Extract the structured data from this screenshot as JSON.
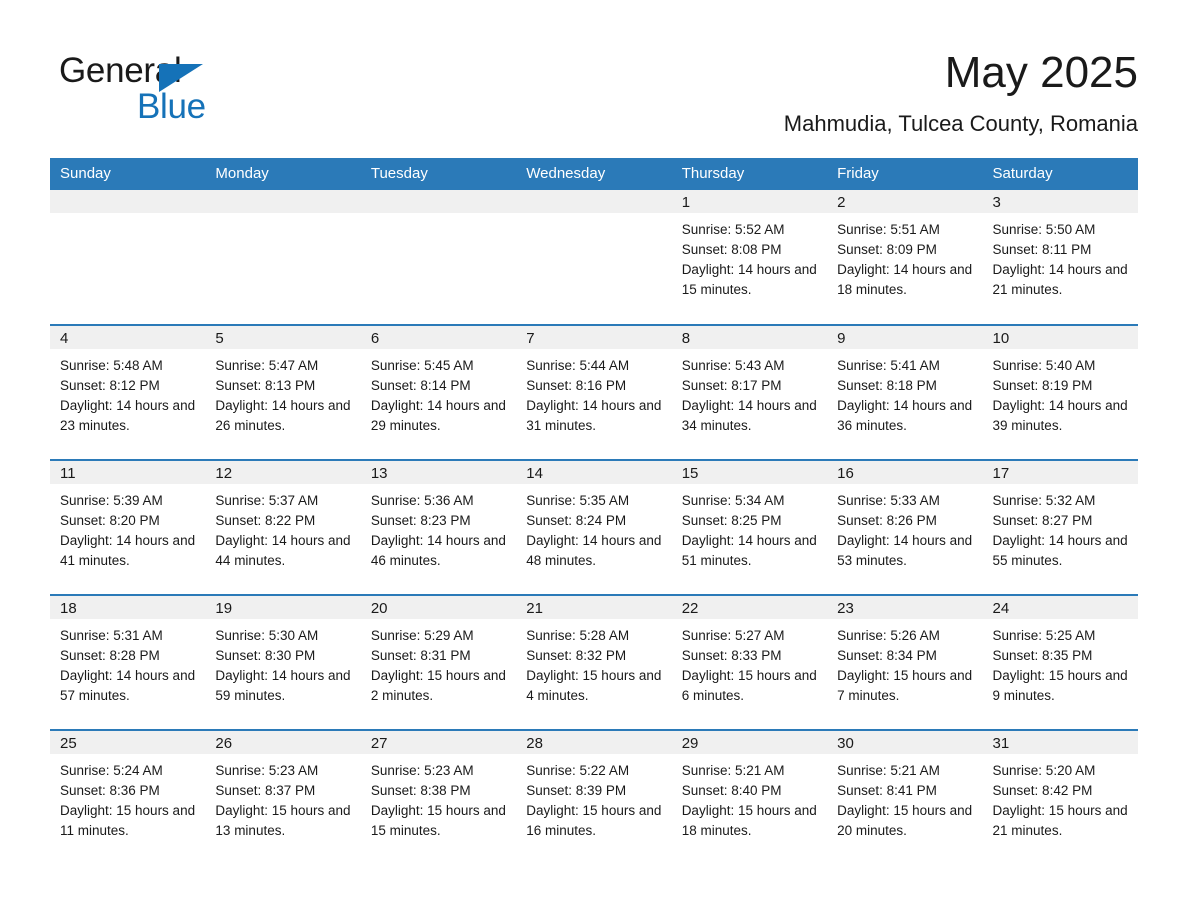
{
  "logo": {
    "word_one": "General",
    "word_two": "Blue",
    "triangle_icon": "triangle-icon",
    "brand_color": "#1572b8"
  },
  "header": {
    "month_title": "May 2025",
    "location": "Mahmudia, Tulcea County, Romania"
  },
  "theme": {
    "header_blue": "#2b7ab8",
    "daynum_band": "#f0f0f0",
    "text": "#1a1a1a"
  },
  "weekday_headers": [
    "Sunday",
    "Monday",
    "Tuesday",
    "Wednesday",
    "Thursday",
    "Friday",
    "Saturday"
  ],
  "labels": {
    "sunrise_prefix": "Sunrise:",
    "sunset_prefix": "Sunset:",
    "daylight_prefix": "Daylight:"
  },
  "weeks": [
    [
      {
        "day": "",
        "sunrise": "",
        "sunset": "",
        "daylight": ""
      },
      {
        "day": "",
        "sunrise": "",
        "sunset": "",
        "daylight": ""
      },
      {
        "day": "",
        "sunrise": "",
        "sunset": "",
        "daylight": ""
      },
      {
        "day": "",
        "sunrise": "",
        "sunset": "",
        "daylight": ""
      },
      {
        "day": "1",
        "sunrise": "Sunrise: 5:52 AM",
        "sunset": "Sunset: 8:08 PM",
        "daylight": "Daylight: 14 hours and 15 minutes."
      },
      {
        "day": "2",
        "sunrise": "Sunrise: 5:51 AM",
        "sunset": "Sunset: 8:09 PM",
        "daylight": "Daylight: 14 hours and 18 minutes."
      },
      {
        "day": "3",
        "sunrise": "Sunrise: 5:50 AM",
        "sunset": "Sunset: 8:11 PM",
        "daylight": "Daylight: 14 hours and 21 minutes."
      }
    ],
    [
      {
        "day": "4",
        "sunrise": "Sunrise: 5:48 AM",
        "sunset": "Sunset: 8:12 PM",
        "daylight": "Daylight: 14 hours and 23 minutes."
      },
      {
        "day": "5",
        "sunrise": "Sunrise: 5:47 AM",
        "sunset": "Sunset: 8:13 PM",
        "daylight": "Daylight: 14 hours and 26 minutes."
      },
      {
        "day": "6",
        "sunrise": "Sunrise: 5:45 AM",
        "sunset": "Sunset: 8:14 PM",
        "daylight": "Daylight: 14 hours and 29 minutes."
      },
      {
        "day": "7",
        "sunrise": "Sunrise: 5:44 AM",
        "sunset": "Sunset: 8:16 PM",
        "daylight": "Daylight: 14 hours and 31 minutes."
      },
      {
        "day": "8",
        "sunrise": "Sunrise: 5:43 AM",
        "sunset": "Sunset: 8:17 PM",
        "daylight": "Daylight: 14 hours and 34 minutes."
      },
      {
        "day": "9",
        "sunrise": "Sunrise: 5:41 AM",
        "sunset": "Sunset: 8:18 PM",
        "daylight": "Daylight: 14 hours and 36 minutes."
      },
      {
        "day": "10",
        "sunrise": "Sunrise: 5:40 AM",
        "sunset": "Sunset: 8:19 PM",
        "daylight": "Daylight: 14 hours and 39 minutes."
      }
    ],
    [
      {
        "day": "11",
        "sunrise": "Sunrise: 5:39 AM",
        "sunset": "Sunset: 8:20 PM",
        "daylight": "Daylight: 14 hours and 41 minutes."
      },
      {
        "day": "12",
        "sunrise": "Sunrise: 5:37 AM",
        "sunset": "Sunset: 8:22 PM",
        "daylight": "Daylight: 14 hours and 44 minutes."
      },
      {
        "day": "13",
        "sunrise": "Sunrise: 5:36 AM",
        "sunset": "Sunset: 8:23 PM",
        "daylight": "Daylight: 14 hours and 46 minutes."
      },
      {
        "day": "14",
        "sunrise": "Sunrise: 5:35 AM",
        "sunset": "Sunset: 8:24 PM",
        "daylight": "Daylight: 14 hours and 48 minutes."
      },
      {
        "day": "15",
        "sunrise": "Sunrise: 5:34 AM",
        "sunset": "Sunset: 8:25 PM",
        "daylight": "Daylight: 14 hours and 51 minutes."
      },
      {
        "day": "16",
        "sunrise": "Sunrise: 5:33 AM",
        "sunset": "Sunset: 8:26 PM",
        "daylight": "Daylight: 14 hours and 53 minutes."
      },
      {
        "day": "17",
        "sunrise": "Sunrise: 5:32 AM",
        "sunset": "Sunset: 8:27 PM",
        "daylight": "Daylight: 14 hours and 55 minutes."
      }
    ],
    [
      {
        "day": "18",
        "sunrise": "Sunrise: 5:31 AM",
        "sunset": "Sunset: 8:28 PM",
        "daylight": "Daylight: 14 hours and 57 minutes."
      },
      {
        "day": "19",
        "sunrise": "Sunrise: 5:30 AM",
        "sunset": "Sunset: 8:30 PM",
        "daylight": "Daylight: 14 hours and 59 minutes."
      },
      {
        "day": "20",
        "sunrise": "Sunrise: 5:29 AM",
        "sunset": "Sunset: 8:31 PM",
        "daylight": "Daylight: 15 hours and 2 minutes."
      },
      {
        "day": "21",
        "sunrise": "Sunrise: 5:28 AM",
        "sunset": "Sunset: 8:32 PM",
        "daylight": "Daylight: 15 hours and 4 minutes."
      },
      {
        "day": "22",
        "sunrise": "Sunrise: 5:27 AM",
        "sunset": "Sunset: 8:33 PM",
        "daylight": "Daylight: 15 hours and 6 minutes."
      },
      {
        "day": "23",
        "sunrise": "Sunrise: 5:26 AM",
        "sunset": "Sunset: 8:34 PM",
        "daylight": "Daylight: 15 hours and 7 minutes."
      },
      {
        "day": "24",
        "sunrise": "Sunrise: 5:25 AM",
        "sunset": "Sunset: 8:35 PM",
        "daylight": "Daylight: 15 hours and 9 minutes."
      }
    ],
    [
      {
        "day": "25",
        "sunrise": "Sunrise: 5:24 AM",
        "sunset": "Sunset: 8:36 PM",
        "daylight": "Daylight: 15 hours and 11 minutes."
      },
      {
        "day": "26",
        "sunrise": "Sunrise: 5:23 AM",
        "sunset": "Sunset: 8:37 PM",
        "daylight": "Daylight: 15 hours and 13 minutes."
      },
      {
        "day": "27",
        "sunrise": "Sunrise: 5:23 AM",
        "sunset": "Sunset: 8:38 PM",
        "daylight": "Daylight: 15 hours and 15 minutes."
      },
      {
        "day": "28",
        "sunrise": "Sunrise: 5:22 AM",
        "sunset": "Sunset: 8:39 PM",
        "daylight": "Daylight: 15 hours and 16 minutes."
      },
      {
        "day": "29",
        "sunrise": "Sunrise: 5:21 AM",
        "sunset": "Sunset: 8:40 PM",
        "daylight": "Daylight: 15 hours and 18 minutes."
      },
      {
        "day": "30",
        "sunrise": "Sunrise: 5:21 AM",
        "sunset": "Sunset: 8:41 PM",
        "daylight": "Daylight: 15 hours and 20 minutes."
      },
      {
        "day": "31",
        "sunrise": "Sunrise: 5:20 AM",
        "sunset": "Sunset: 8:42 PM",
        "daylight": "Daylight: 15 hours and 21 minutes."
      }
    ]
  ]
}
